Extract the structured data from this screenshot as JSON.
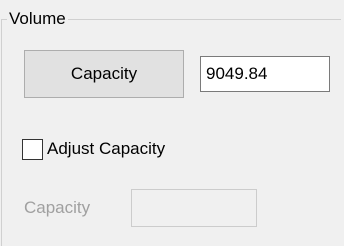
{
  "group": {
    "title": "Volume"
  },
  "capacity_button": {
    "label": "Capacity"
  },
  "capacity_value": {
    "value": "9049.84"
  },
  "adjust_checkbox": {
    "label": "Adjust Capacity",
    "checked": false
  },
  "adjust_capacity": {
    "label": "Capacity",
    "value": "",
    "enabled": false
  },
  "colors": {
    "background": "#f0f0f0",
    "button_face": "#e1e1e1",
    "disabled_text": "#a0a0a0"
  }
}
